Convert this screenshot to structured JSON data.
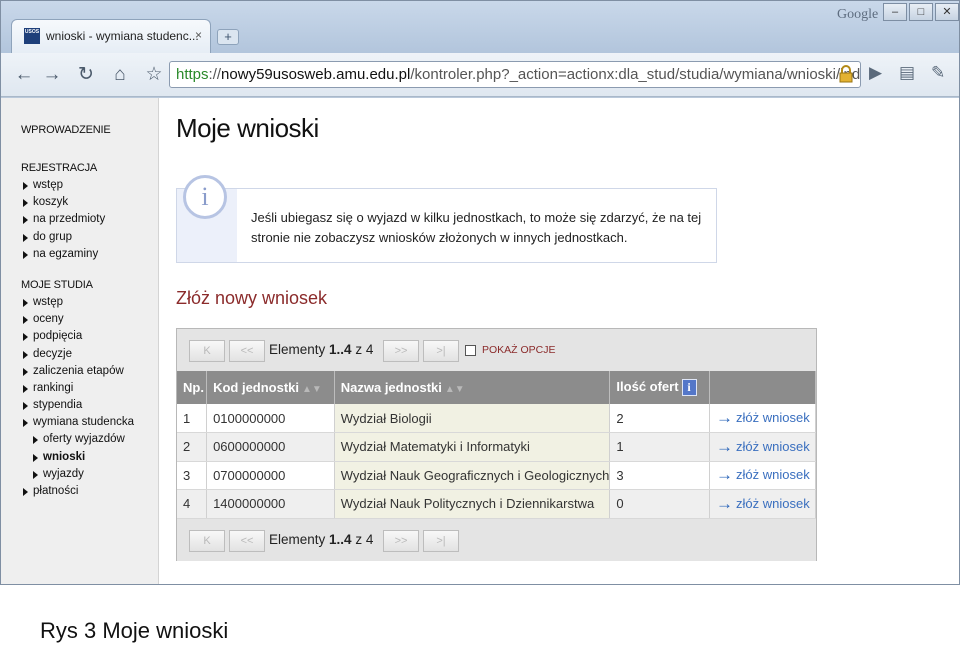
{
  "browser": {
    "tab_title": "wnioski - wymiana studenc...",
    "favicon_text": "USOS",
    "tab_close": "×",
    "new_tab": "+",
    "google_label": "Google",
    "window_buttons": [
      "–",
      "□",
      "✕"
    ],
    "url_scheme": "https",
    "url_sep": "://",
    "url_domain": "nowy59usosweb.amu.edu.pl",
    "url_path": "/kontroler.php?_action=actionx:dla_stud/studia/wymiana/wnioski/inde"
  },
  "sidebar": {
    "intro": "WPROWADZENIE",
    "registration_heading": "REJESTRACJA",
    "registration_items": [
      "wstęp",
      "koszyk",
      "na przedmioty",
      "do grup",
      "na egzaminy"
    ],
    "studies_heading": "MOJE STUDIA",
    "studies_items": [
      "wstęp",
      "oceny",
      "podpięcia",
      "decyzje",
      "zaliczenia etapów",
      "rankingi",
      "stypendia",
      "wymiana studencka"
    ],
    "exchange_sub_items": [
      "oferty wyjazdów",
      "wnioski",
      "wyjazdy"
    ],
    "payments": "płatności",
    "active_item": "wnioski"
  },
  "main": {
    "title": "Moje wnioski",
    "info_icon": "i",
    "info_text": "Jeśli ubiegasz się o wyjazd w kilku jednostkach, to może się zdarzyć, że na tej stronie nie zobaczysz wniosków złożonych w innych jednostkach.",
    "section_title": "Złóż nowy wniosek"
  },
  "pager": {
    "first": "K",
    "prev": "<<",
    "next": ">>",
    "last": ">|",
    "label": "Elementy",
    "range": "1..4",
    "of": "z 4",
    "options_label": "POKAŻ OPCJE"
  },
  "table": {
    "headers": {
      "no": "Np.",
      "code": "Kod jednostki",
      "name": "Nazwa jednostki",
      "offers": "Ilość ofert",
      "offers_info": "i"
    },
    "action_label": "złóż wniosek",
    "rows": [
      {
        "no": "1",
        "code": "0100000000",
        "name": "Wydział Biologii",
        "offers": "2"
      },
      {
        "no": "2",
        "code": "0600000000",
        "name": "Wydział Matematyki i Informatyki",
        "offers": "1"
      },
      {
        "no": "3",
        "code": "0700000000",
        "name": "Wydział Nauk Geograficznych i Geologicznych",
        "offers": "3"
      },
      {
        "no": "4",
        "code": "1400000000",
        "name": "Wydział Nauk Politycznych i Dziennikarstwa",
        "offers": "0"
      }
    ]
  },
  "caption": "Rys 3 Moje wnioski"
}
